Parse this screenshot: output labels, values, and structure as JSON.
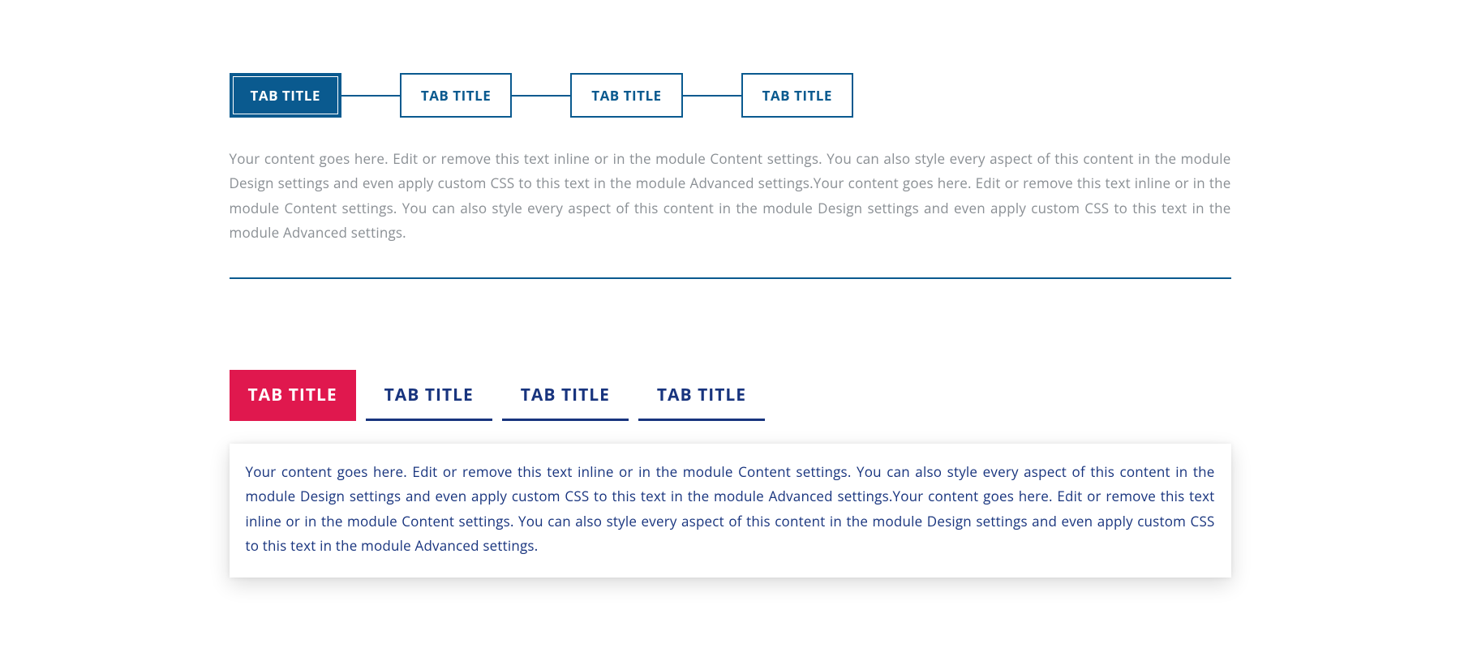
{
  "colors": {
    "primary_blue": "#0A5A8F",
    "dark_blue": "#18347E",
    "active_pink": "#E0184E",
    "muted_text": "#8a8f94"
  },
  "tab_module_1": {
    "active_index": 0,
    "tabs": [
      {
        "label": "TAB TITLE"
      },
      {
        "label": "TAB TITLE"
      },
      {
        "label": "TAB TITLE"
      },
      {
        "label": "TAB TITLE"
      }
    ],
    "content": "Your content goes here. Edit or remove this text inline or in the module Content settings. You can also style every aspect of this content in the module Design settings and even apply custom CSS to this text in the module Advanced settings.Your content goes here. Edit or remove this text inline or in the module Content settings. You can also style every aspect of this content in the module Design settings and even apply custom CSS to this text in the module Advanced settings."
  },
  "tab_module_2": {
    "active_index": 0,
    "tabs": [
      {
        "label": "TAB TITLE"
      },
      {
        "label": "TAB TITLE"
      },
      {
        "label": "TAB TITLE"
      },
      {
        "label": "TAB TITLE"
      }
    ],
    "content": "Your content goes here. Edit or remove this text inline or in the module Content settings. You can also style every aspect of this content in the module Design settings and even apply custom CSS to this text in the module Advanced settings.Your content goes here. Edit or remove this text inline or in the module Content settings. You can also style every aspect of this content in the module Design settings and even apply custom CSS to this text in the module Advanced settings."
  }
}
